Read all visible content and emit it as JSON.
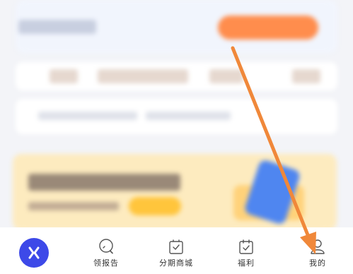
{
  "tabbar": {
    "items": [
      {
        "label": "",
        "icon": "home-logo-icon"
      },
      {
        "label": "领报告",
        "icon": "report-magnifier-icon"
      },
      {
        "label": "分期商城",
        "icon": "shopping-bag-icon"
      },
      {
        "label": "福利",
        "icon": "calendar-gift-icon"
      },
      {
        "label": "我的",
        "icon": "user-profile-icon"
      }
    ]
  },
  "colors": {
    "accent": "#3d49e8",
    "annotation_arrow": "#f0883a",
    "banner": "#fdebbf",
    "cta": "#ff8d4d"
  }
}
